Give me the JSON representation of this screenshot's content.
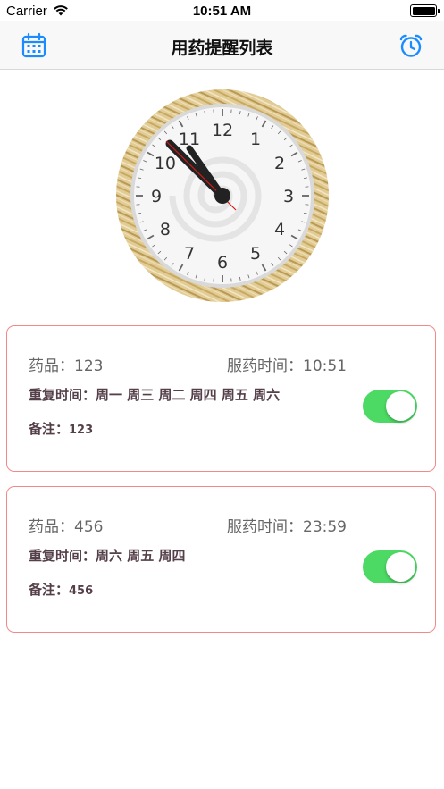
{
  "status_bar": {
    "carrier": "Carrier",
    "time": "10:51 AM"
  },
  "nav": {
    "title": "用药提醒列表",
    "left_icon": "calendar-icon",
    "right_icon": "alarm-clock-icon"
  },
  "clock": {
    "numbers": [
      "12",
      "1",
      "2",
      "3",
      "4",
      "5",
      "6",
      "7",
      "8",
      "9",
      "10",
      "11"
    ],
    "hour_hand": "10:51"
  },
  "reminders": [
    {
      "med_label": "药品：",
      "med_value": "123",
      "time_label": "服药时间：",
      "time_value": "10:51",
      "repeat_label": "重复时间：",
      "repeat_value": "周一 周三 周二 周四 周五 周六",
      "note_label": "备注：",
      "note_value": "123",
      "enabled": true
    },
    {
      "med_label": "药品：",
      "med_value": "456",
      "time_label": "服药时间：",
      "time_value": "23:59",
      "repeat_label": "重复时间：",
      "repeat_value": "周六 周五 周四",
      "note_label": "备注：",
      "note_value": "456",
      "enabled": true
    }
  ],
  "colors": {
    "accent": "#1a8cff",
    "switch_on": "#4cd964",
    "card_border": "#f08a8a",
    "label_text": "#55404a"
  }
}
